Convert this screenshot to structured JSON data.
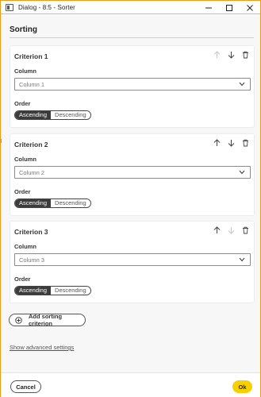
{
  "window": {
    "title": "Dialog - 8:5 - Sorter",
    "accent": "#f09a1a",
    "controls": [
      "minimize-icon",
      "maximize-icon",
      "close-icon"
    ]
  },
  "heading": "Sorting",
  "criteria": [
    {
      "title": "Criterion 1",
      "column_label": "Column",
      "column_value": "Column 1",
      "order_label": "Order",
      "order_options": [
        "Ascending",
        "Descending"
      ],
      "order_selected": "Ascending",
      "move_up_enabled": false,
      "move_down_enabled": true
    },
    {
      "title": "Criterion 2",
      "column_label": "Column",
      "column_value": "Column 2",
      "order_label": "Order",
      "order_options": [
        "Ascending",
        "Descending"
      ],
      "order_selected": "Ascending",
      "move_up_enabled": true,
      "move_down_enabled": true
    },
    {
      "title": "Criterion 3",
      "column_label": "Column",
      "column_value": "Column 3",
      "order_label": "Order",
      "order_options": [
        "Ascending",
        "Descending"
      ],
      "order_selected": "Ascending",
      "move_up_enabled": true,
      "move_down_enabled": false
    }
  ],
  "add_button": "Add sorting criterion",
  "advanced_link": "Show advanced settings",
  "footer": {
    "cancel": "Cancel",
    "ok": "Ok",
    "ok_color": "#f7d000"
  }
}
